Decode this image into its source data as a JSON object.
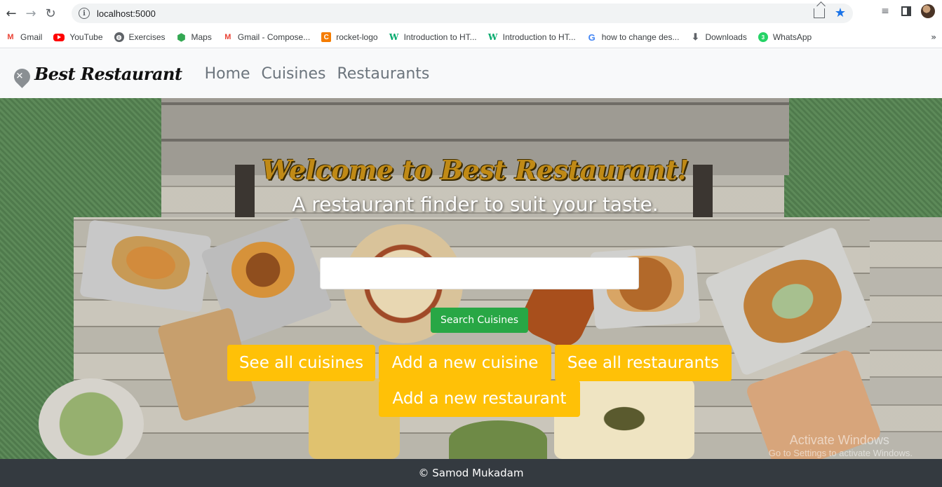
{
  "browser": {
    "url": "localhost:5000",
    "bookmarks": [
      {
        "label": "Gmail",
        "icon": "gmail-icon"
      },
      {
        "label": "YouTube",
        "icon": "youtube-icon"
      },
      {
        "label": "Exercises",
        "icon": "globe-icon"
      },
      {
        "label": "Maps",
        "icon": "maps-icon"
      },
      {
        "label": "Gmail - Compose...",
        "icon": "gmail-icon"
      },
      {
        "label": "rocket-logo",
        "icon": "rocket-icon"
      },
      {
        "label": "Introduction to HT...",
        "icon": "w3schools-icon"
      },
      {
        "label": "Introduction to HT...",
        "icon": "w3schools-icon"
      },
      {
        "label": "how to change des...",
        "icon": "google-icon"
      },
      {
        "label": "Downloads",
        "icon": "download-icon"
      },
      {
        "label": "WhatsApp",
        "icon": "whatsapp-icon"
      }
    ],
    "more": "»"
  },
  "navbar": {
    "brand": "Best Restaurant",
    "links": [
      "Home",
      "Cuisines",
      "Restaurants"
    ]
  },
  "hero": {
    "title": "Welcome to Best Restaurant!",
    "subtitle": "A restaurant finder to suit your taste.",
    "search_value": "",
    "search_button": "Search Cuisines",
    "actions": [
      "See all cuisines",
      "Add a new cuisine",
      "See all restaurants",
      "Add a new restaurant"
    ]
  },
  "watermark": {
    "line1": "Activate Windows",
    "line2": "Go to Settings to activate Windows."
  },
  "footer": {
    "text": "© Samod Mukadam"
  }
}
